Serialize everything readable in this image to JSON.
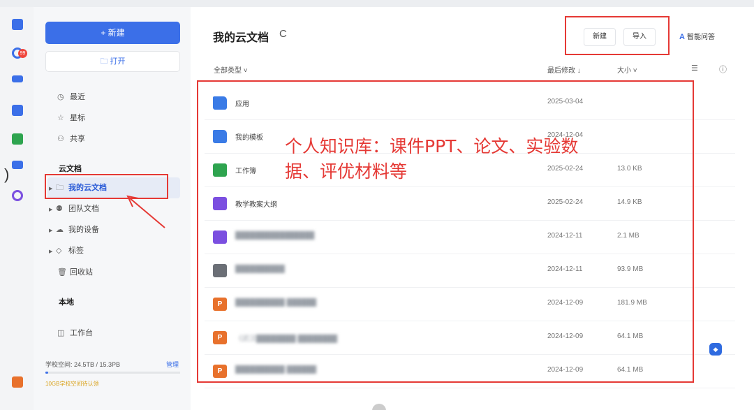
{
  "sidebar": {
    "new_button": "+ 新建",
    "open_button": "打开",
    "nav": {
      "recent": "最近",
      "starred": "星标",
      "shared": "共享"
    },
    "cloud_section": "云文档",
    "cloud_items": {
      "my_cloud_docs": "我的云文档",
      "team_docs": "团队文档",
      "my_devices": "我的设备",
      "tags": "标签",
      "recycle_bin": "回收站"
    },
    "local_section": "本地",
    "workbench": "工作台",
    "storage": {
      "label": "学校空间: 24.5TB / 15.3PB",
      "manage": "管理",
      "used_fraction": 0.0016,
      "note": "10GB学校空间待认领"
    },
    "rail_badge": "99"
  },
  "header": {
    "title": "我的云文档",
    "new_button": "新建",
    "import_button": "导入",
    "ai_button": "智能问答"
  },
  "columns": {
    "type_filter": "全部类型 ˅",
    "modified": "最后修改 ↓",
    "size": "大小 ˅"
  },
  "files": [
    {
      "name": "应用",
      "date": "2025-03-04",
      "size": "",
      "icon": "folder-icon",
      "color": "#3a7be6",
      "glyph": ""
    },
    {
      "name": "我的模板",
      "date": "2024-12-04",
      "size": "",
      "icon": "folder-icon",
      "color": "#3a7be6",
      "glyph": ""
    },
    {
      "name": "工作簿",
      "date": "2025-02-24",
      "size": "13.0 KB",
      "icon": "spreadsheet-icon",
      "color": "#2ea44f",
      "glyph": ""
    },
    {
      "name": "教学教案大纲",
      "date": "2025-02-24",
      "size": "14.9 KB",
      "icon": "document-icon",
      "color": "#7b4fe0",
      "glyph": ""
    },
    {
      "name": "████████████████",
      "date": "2024-12-11",
      "size": "2.1 MB",
      "icon": "document-icon",
      "color": "#7b4fe0",
      "glyph": ""
    },
    {
      "name": "██████████",
      "date": "2024-12-11",
      "size": "93.9 MB",
      "icon": "image-icon",
      "color": "#6b6f76",
      "glyph": ""
    },
    {
      "name": "██████████ ██████",
      "date": "2024-12-09",
      "size": "181.9 MB",
      "icon": "presentation-icon",
      "color": "#e8712c",
      "glyph": "P"
    },
    {
      "name": "《武汉████████ ████████",
      "date": "2024-12-09",
      "size": "64.1 MB",
      "icon": "presentation-icon",
      "color": "#e8712c",
      "glyph": "P"
    },
    {
      "name": "██████████ ██████",
      "date": "2024-12-09",
      "size": "64.1 MB",
      "icon": "presentation-icon",
      "color": "#e8712c",
      "glyph": "P"
    }
  ],
  "annotation": {
    "text": "个人知识库：课件PPT、论文、实验数据、评优材料等",
    "color": "#e53935"
  }
}
